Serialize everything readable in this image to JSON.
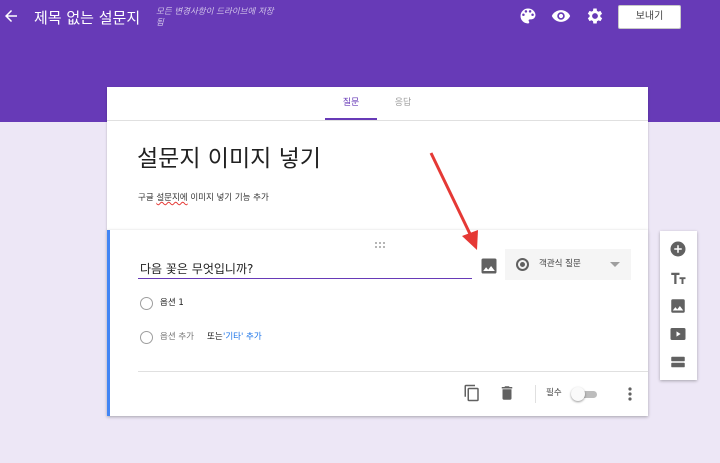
{
  "header": {
    "title": "제목 없는 설문지",
    "save_status": "모든 변경사항이 드라이브에 저장됨",
    "send_label": "보내기",
    "icons": [
      "back-arrow-icon",
      "palette-icon",
      "eye-icon",
      "gear-icon"
    ],
    "colors": {
      "theme": "#673ab7",
      "background": "#ede7f6"
    }
  },
  "tabs": [
    {
      "label": "질문",
      "active": true
    },
    {
      "label": "응답",
      "active": false
    }
  ],
  "form": {
    "title": "설문지 이미지 넣기",
    "description_parts": [
      "구글 ",
      "설문지에",
      " 이미지 넣기 기능 추가"
    ]
  },
  "question": {
    "text": "다음 꽃은 무엇입니까?",
    "type_label": "객관식 질문",
    "options": [
      {
        "label": "옵션 1"
      }
    ],
    "add_option": {
      "add_label": "옵션 추가",
      "or_label": "또는",
      "other_label": "'기타' 추가"
    },
    "required_label": "필수",
    "required": false
  },
  "side_toolbar": [
    "add-question-icon",
    "title-text-icon",
    "image-icon",
    "video-icon",
    "section-icon"
  ]
}
